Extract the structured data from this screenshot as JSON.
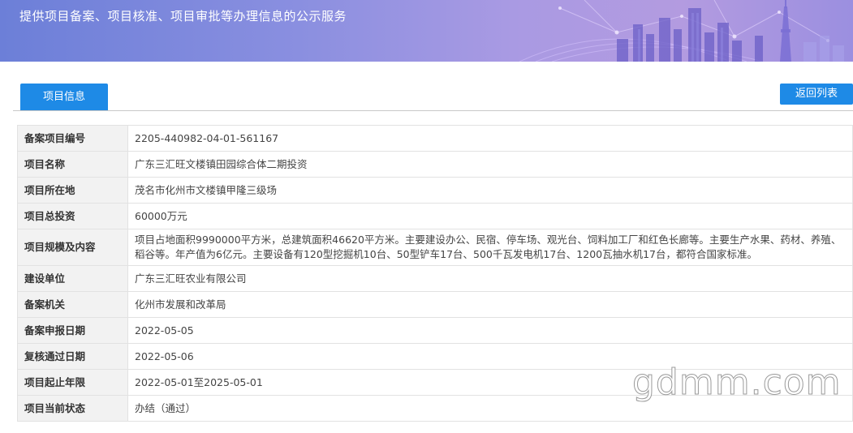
{
  "banner": {
    "title": "提供项目备案、项目核准、项目审批等办理信息的公示服务"
  },
  "tabs": {
    "active_label": "项目信息"
  },
  "actions": {
    "back_label": "返回列表"
  },
  "details": [
    {
      "label": "备案项目编号",
      "value": "2205-440982-04-01-561167"
    },
    {
      "label": "项目名称",
      "value": "广东三汇旺文楼镇田园综合体二期投资"
    },
    {
      "label": "项目所在地",
      "value": "茂名市化州市文楼镇甲隆三级场"
    },
    {
      "label": "项目总投资",
      "value": "60000万元"
    },
    {
      "label": "项目规模及内容",
      "value": "项目占地面积9990000平方米，总建筑面积46620平方米。主要建设办公、民宿、停车场、观光台、饲料加工厂和红色长廊等。主要生产水果、药材、养殖、稻谷等。年产值为6亿元。主要设备有120型挖掘机10台、50型铲车17台、500千瓦发电机17台、1200瓦抽水机17台，都符合国家标准。"
    },
    {
      "label": "建设单位",
      "value": "广东三汇旺农业有限公司"
    },
    {
      "label": "备案机关",
      "value": "化州市发展和改革局"
    },
    {
      "label": "备案申报日期",
      "value": "2022-05-05"
    },
    {
      "label": "复核通过日期",
      "value": "2022-05-06"
    },
    {
      "label": "项目起止年限",
      "value": "2022-05-01至2025-05-01"
    },
    {
      "label": "项目当前状态",
      "value": "办结（通过）"
    }
  ],
  "watermark": {
    "text": "gdmm.com"
  },
  "colors": {
    "accent": "#1e8ae6",
    "banner_start": "#6c7fd8",
    "banner_end": "#b39be0",
    "label_bg": "#f2f2f2",
    "border": "#e2e2e2"
  }
}
